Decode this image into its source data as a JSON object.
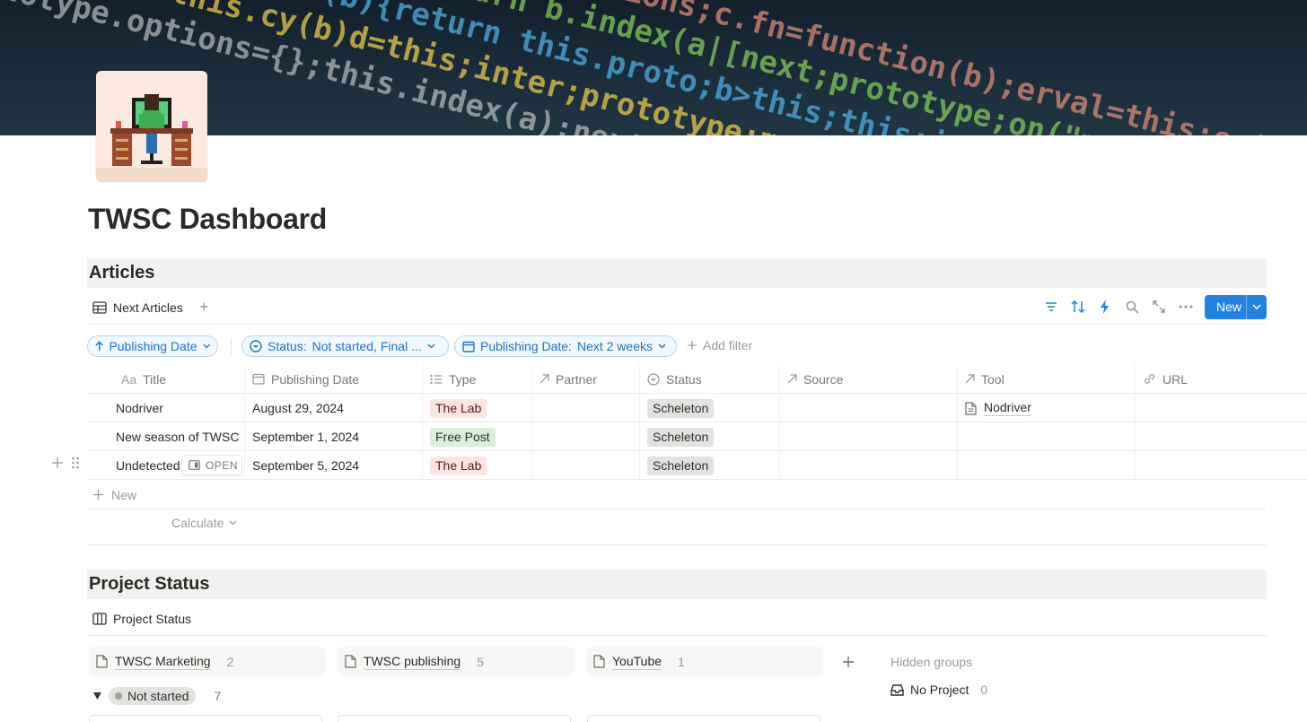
{
  "page": {
    "title": "TWSC Dashboard"
  },
  "articles": {
    "heading": "Articles",
    "view": {
      "label": "Next Articles",
      "icon": "table-icon"
    },
    "toolbar": {
      "icons": [
        "filter-icon",
        "sort-icon",
        "automation-bolt-icon",
        "search-icon",
        "expand-icon",
        "more-icon"
      ],
      "new_label": "New"
    },
    "filters": {
      "sort_chip": "Publishing Date",
      "status_chip": {
        "key": "Status:",
        "value": "Not started, Final ..."
      },
      "date_chip": {
        "key": "Publishing Date:",
        "value": "Next 2 weeks"
      },
      "add_filter": "Add filter"
    },
    "columns": [
      {
        "label": "Title",
        "prefix": "Aa"
      },
      {
        "label": "Publishing Date"
      },
      {
        "label": "Type"
      },
      {
        "label": "Partner"
      },
      {
        "label": "Status"
      },
      {
        "label": "Source"
      },
      {
        "label": "Tool"
      },
      {
        "label": "URL"
      }
    ],
    "rows": [
      {
        "title": "Nodriver",
        "date": "August 29, 2024",
        "type": "The Lab",
        "status": "Scheleton",
        "tool": "Nodriver"
      },
      {
        "title": "New season of TWSC",
        "date": "September 1, 2024",
        "type": "Free Post",
        "status": "Scheleton",
        "tool": ""
      },
      {
        "title": "Undetected",
        "date": "September 5, 2024",
        "type": "The Lab",
        "status": "Scheleton",
        "tool": ""
      }
    ],
    "open_label": "OPEN",
    "new_row": "New",
    "calculate": "Calculate"
  },
  "project_status": {
    "heading": "Project Status",
    "view": {
      "label": "Project Status",
      "icon": "board-icon"
    },
    "groups": [
      {
        "name": "TWSC Marketing",
        "count": "2"
      },
      {
        "name": "TWSC publishing",
        "count": "5"
      },
      {
        "name": "YouTube",
        "count": "1"
      }
    ],
    "hidden_groups_label": "Hidden groups",
    "no_project": {
      "name": "No Project",
      "count": "0"
    },
    "status_group": {
      "name": "Not started",
      "count": "7"
    }
  },
  "colors": {
    "accent": "#2383e2",
    "tag_lab": "#fbe4e4",
    "tag_free": "#dbeddb",
    "tag_status": "#e3e2e0"
  }
}
